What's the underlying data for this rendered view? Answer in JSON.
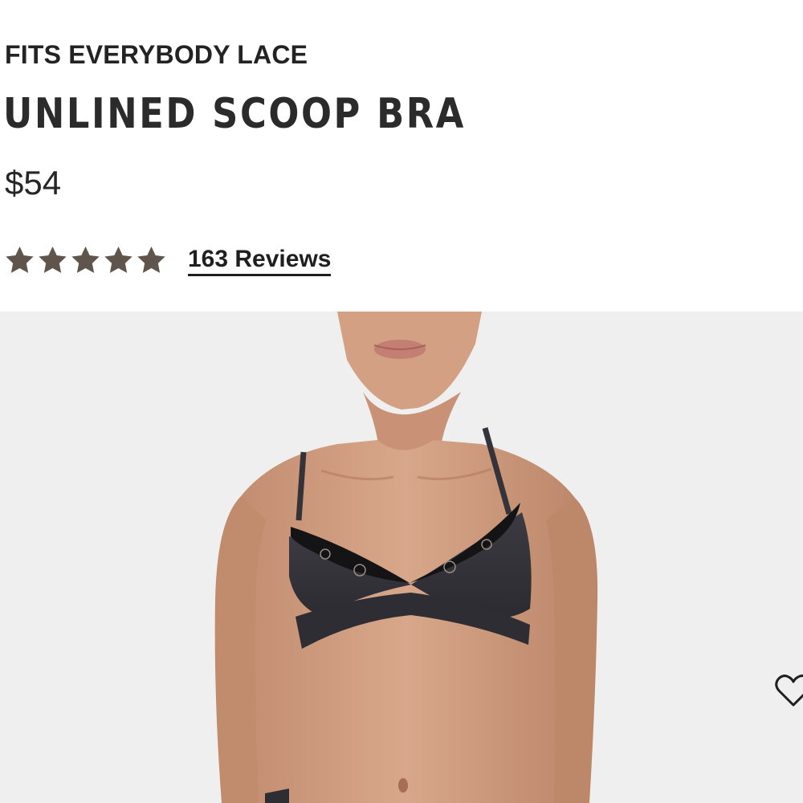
{
  "product": {
    "collection": "FITS EVERYBODY LACE",
    "title": "UNLINED SCOOP BRA",
    "price": "$54",
    "rating": {
      "stars": 5,
      "max_stars": 5,
      "star_color": "#5f554c",
      "reviews_label": "163 Reviews"
    }
  },
  "gallery": {
    "background_color": "#efefef",
    "image_alt": "Model wearing the Unlined Scoop Bra in dark grey with black lace trim",
    "wishlist_icon": "heart-outline-icon"
  }
}
